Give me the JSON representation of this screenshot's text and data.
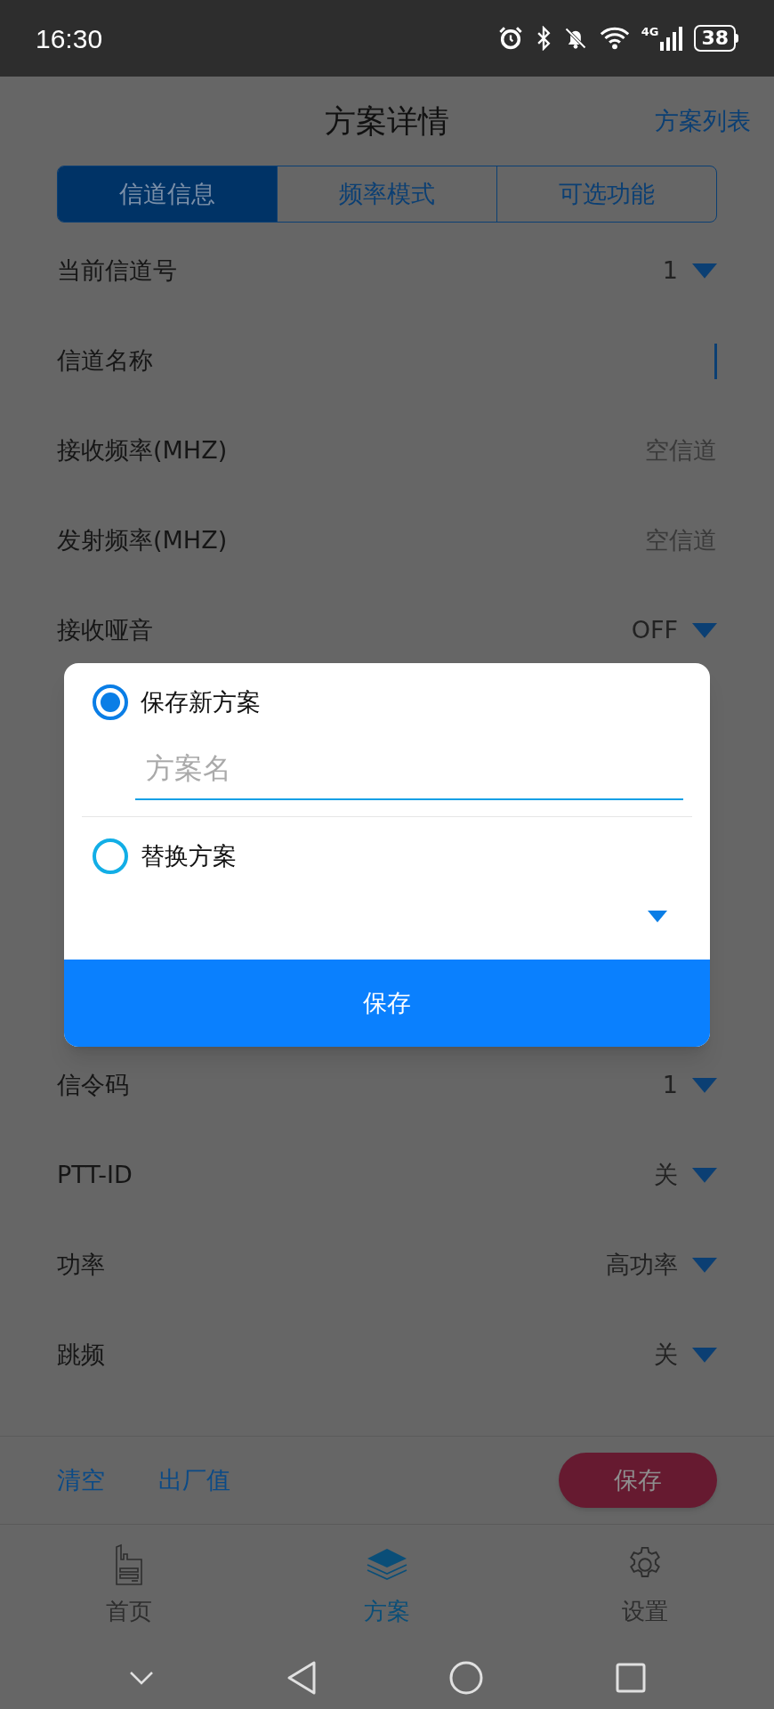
{
  "status_bar": {
    "time": "16:30",
    "network": "4G",
    "battery": "38"
  },
  "header": {
    "title": "方案详情",
    "link": "方案列表"
  },
  "tabs": [
    {
      "label": "信道信息",
      "selected": true
    },
    {
      "label": "频率模式",
      "selected": false
    },
    {
      "label": "可选功能",
      "selected": false
    }
  ],
  "rows_top": [
    {
      "label": "当前信道号",
      "kind": "dropdown",
      "value": "1"
    },
    {
      "label": "信道名称",
      "kind": "field"
    },
    {
      "label": "接收频率(MHZ)",
      "kind": "text",
      "value": "空信道"
    },
    {
      "label": "发射频率(MHZ)",
      "kind": "text",
      "value": "空信道"
    },
    {
      "label": "接收哑音",
      "kind": "dropdown",
      "value": "OFF"
    }
  ],
  "rows_bottom": [
    {
      "label": "信令码",
      "kind": "dropdown",
      "value": "1"
    },
    {
      "label": "PTT-ID",
      "kind": "dropdown",
      "value": "关"
    },
    {
      "label": "功率",
      "kind": "dropdown",
      "value": "高功率"
    },
    {
      "label": "跳频",
      "kind": "dropdown",
      "value": "关"
    }
  ],
  "dialog": {
    "options": [
      {
        "label": "保存新方案",
        "selected": true
      },
      {
        "label": "替换方案",
        "selected": false
      }
    ],
    "name_field": {
      "placeholder": "方案名"
    },
    "button": "保存"
  },
  "action_bar": {
    "links": [
      "清空",
      "出厂值"
    ],
    "button": "保存"
  },
  "bottom_nav": [
    {
      "label": "首页",
      "kind": "home",
      "selected": false
    },
    {
      "label": "方案",
      "kind": "plans",
      "selected": true
    },
    {
      "label": "设置",
      "kind": "settings",
      "selected": false
    }
  ]
}
